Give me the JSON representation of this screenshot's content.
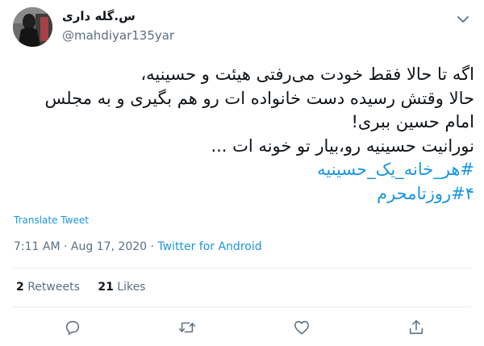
{
  "user": {
    "display_name": "س.گله داری",
    "handle": "@mahdiyar135yar",
    "avatar_icon": "profile-photo"
  },
  "tweet": {
    "lines": [
      "اگه تا حالا فقط خودت می‌رفتی هیئت و حسینیه،",
      "حالا وقتش رسیده دست خانواده ات رو هم بگیری و به مجلس",
      "امام حسین ببری!",
      "نورانیت حسینیه رو،بیار تو خونه ات ..."
    ],
    "hashtags": [
      "#هر_خانه_یک_حسینیه",
      "#۴روزتامحرم"
    ]
  },
  "translate_label": "Translate Tweet",
  "meta": {
    "time": "7:11 AM",
    "separator": "·",
    "date": "Aug 17, 2020",
    "source": "Twitter for Android"
  },
  "stats": {
    "retweets_count": "2",
    "retweets_label": "Retweets",
    "likes_count": "21",
    "likes_label": "Likes"
  },
  "actions": [
    "reply-icon",
    "retweet-icon",
    "like-icon",
    "share-icon"
  ],
  "colors": {
    "link": "#1b95e0",
    "muted": "#5b7083",
    "text": "#0f1419",
    "divider": "#e6ecf0"
  }
}
